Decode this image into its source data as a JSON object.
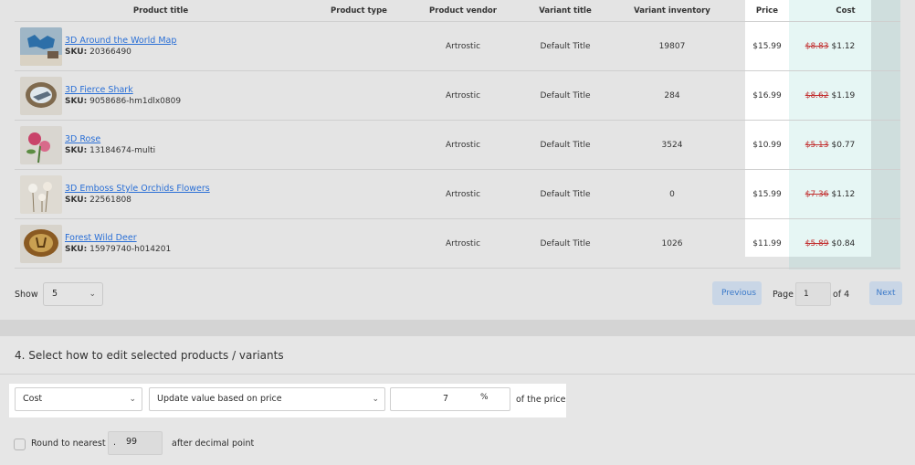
{
  "table": {
    "headers": {
      "product_title": "Product title",
      "product_type": "Product type",
      "product_vendor": "Product vendor",
      "variant_title": "Variant title",
      "variant_inventory": "Variant inventory",
      "price": "Price",
      "cost": "Cost"
    },
    "sku_label": "SKU:",
    "rows": [
      {
        "title": "3D Around the World Map",
        "sku": "20366490",
        "type": "",
        "vendor": "Artrostic",
        "variant": "Default Title",
        "inventory": "19807",
        "price": "$15.99",
        "old_cost": "$8.83",
        "new_cost": "$1.12"
      },
      {
        "title": "3D Fierce Shark",
        "sku": "9058686-hm1dlx0809",
        "type": "",
        "vendor": "Artrostic",
        "variant": "Default Title",
        "inventory": "284",
        "price": "$16.99",
        "old_cost": "$8.62",
        "new_cost": "$1.19"
      },
      {
        "title": "3D Rose",
        "sku": "13184674-multi",
        "type": "",
        "vendor": "Artrostic",
        "variant": "Default Title",
        "inventory": "3524",
        "price": "$10.99",
        "old_cost": "$5.13",
        "new_cost": "$0.77"
      },
      {
        "title": "3D Emboss Style Orchids Flowers",
        "sku": "22561808",
        "type": "",
        "vendor": "Artrostic",
        "variant": "Default Title",
        "inventory": "0",
        "price": "$15.99",
        "old_cost": "$7.36",
        "new_cost": "$1.12"
      },
      {
        "title": "Forest Wild Deer",
        "sku": "15979740-h014201",
        "type": "",
        "vendor": "Artrostic",
        "variant": "Default Title",
        "inventory": "1026",
        "price": "$11.99",
        "old_cost": "$5.89",
        "new_cost": "$0.84"
      }
    ]
  },
  "pagination": {
    "show_label": "Show",
    "page_size": "5",
    "previous_label": "Previous",
    "page_label": "Page",
    "current_page": "1",
    "of_label": "of 4",
    "next_label": "Next"
  },
  "edit_section": {
    "title": "4. Select how to edit selected products / variants",
    "field_select": "Cost",
    "method_select": "Update value based on price",
    "value": "7",
    "unit": "%",
    "suffix": "of the price",
    "round_label": "Round to nearest",
    "round_checked": false,
    "decimal_prefix": ".",
    "decimal_value": "99",
    "after_label": "after decimal point"
  },
  "colors": {
    "link": "#2a6fd6",
    "old_cost": "#c23030",
    "highlight": "#ffffff",
    "cost_column": "#e6f6f4",
    "pager_button": "#c9d6e6"
  },
  "icons": {
    "chevron": "chevron-down-icon"
  }
}
